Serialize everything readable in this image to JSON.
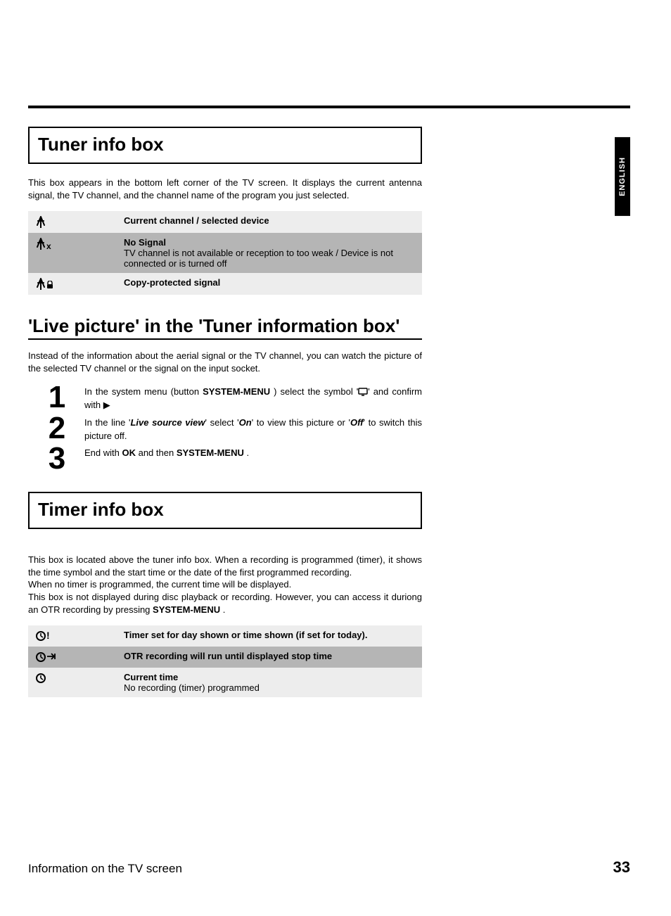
{
  "lang_tab": "ENGLISH",
  "section1": {
    "title": "Tuner info box",
    "intro": "This box appears in the bottom left corner of the TV screen. It displays the current antenna signal, the TV channel, and the channel name of the program you just selected.",
    "rows": [
      {
        "icon": "antenna",
        "title": "Current channel / selected device",
        "desc": ""
      },
      {
        "icon": "antenna-x",
        "title": "No Signal",
        "desc": "TV channel is not available or reception to too weak / Device is not connected or is turned off"
      },
      {
        "icon": "antenna-lock",
        "title": "Copy-protected signal",
        "desc": ""
      }
    ]
  },
  "section2": {
    "title": "'Live picture' in the 'Tuner information box'",
    "intro": "Instead of the information about the aerial signal or the TV channel, you can watch the picture of the selected TV channel or the signal on the input socket.",
    "steps": {
      "s1_a": "In the system menu (button ",
      "s1_btn1": "SYSTEM-MENU",
      "s1_b": " ) select the symbol '",
      "s1_c": "' and confirm with ",
      "s2_a": "In the line '",
      "s2_b": "Live source view",
      "s2_c": "' select '",
      "s2_d": "On",
      "s2_e": "' to view this picture or '",
      "s2_f": "Off",
      "s2_g": "' to switch this picture off.",
      "s3_a": "End with ",
      "s3_ok": "OK",
      "s3_b": " and then ",
      "s3_btn": "SYSTEM-MENU",
      "s3_c": " ."
    }
  },
  "section3": {
    "title": "Timer info box",
    "intro": "This box is located above the tuner info box. When a recording is programmed (timer), it shows the time symbol and the start time or the date of the first programmed recording.\nWhen no timer is programmed, the current time will be displayed.\nThis box is not displayed during disc playback or recording. However, you can access it duriong an OTR recording by pressing ",
    "intro_btn": "SYSTEM-MENU",
    "intro_end": " .",
    "rows": [
      {
        "icon": "clock-excl",
        "title": "Timer set for day shown or time shown (if set for today).",
        "desc": ""
      },
      {
        "icon": "clock-arrow",
        "title": "OTR recording will run until displayed stop time",
        "desc": ""
      },
      {
        "icon": "clock",
        "title": "Current time",
        "desc": "No recording (timer) programmed"
      }
    ]
  },
  "footer": {
    "text": "Information on the TV screen",
    "page": "33"
  }
}
